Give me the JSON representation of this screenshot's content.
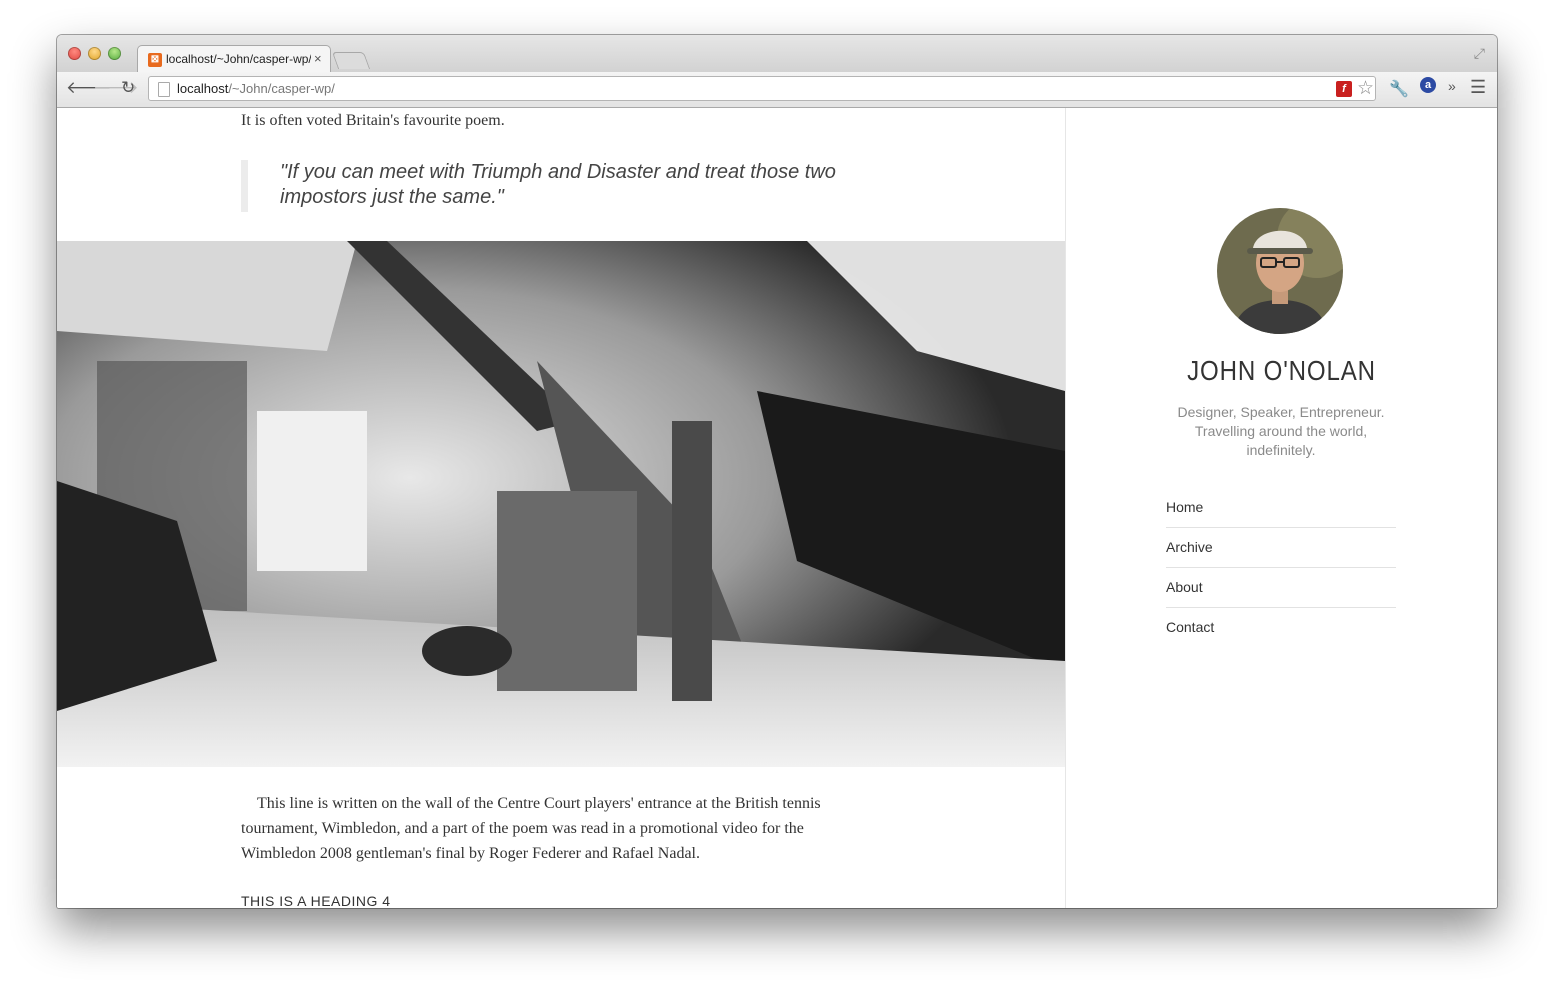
{
  "browser": {
    "tab_title": "localhost/~John/casper-wp/",
    "tab_close": "×",
    "url_host": "localhost",
    "url_path": "/~John/casper-wp/",
    "icons": [
      "back-icon",
      "forward-icon",
      "reload-icon",
      "page-icon",
      "flash-extension-icon",
      "bookmark-star-icon",
      "wrench-icon",
      "extension-icon",
      "overflow-chevron-icon",
      "menu-icon",
      "fullscreen-icon"
    ]
  },
  "post": {
    "intro": "It is often voted Britain's favourite poem.",
    "quote": "\"If you can meet with Triumph and Disaster and treat those two impostors just the same.\"",
    "body": "This line is written on the wall of the Centre Court players' entrance at the British tennis tournament, Wimbledon, and a part of the poem was read in a promotional video for the Wimbledon 2008 gentleman's final by Roger Federer and Rafael Nadal.",
    "heading4": "THIS IS A HEADING 4"
  },
  "sidebar": {
    "author_name": "JOHN O'NOLAN",
    "bio": "Designer, Speaker, Entrepreneur. Travelling around the world, indefinitely.",
    "nav": [
      {
        "label": "Home"
      },
      {
        "label": "Archive"
      },
      {
        "label": "About"
      },
      {
        "label": "Contact"
      }
    ]
  }
}
